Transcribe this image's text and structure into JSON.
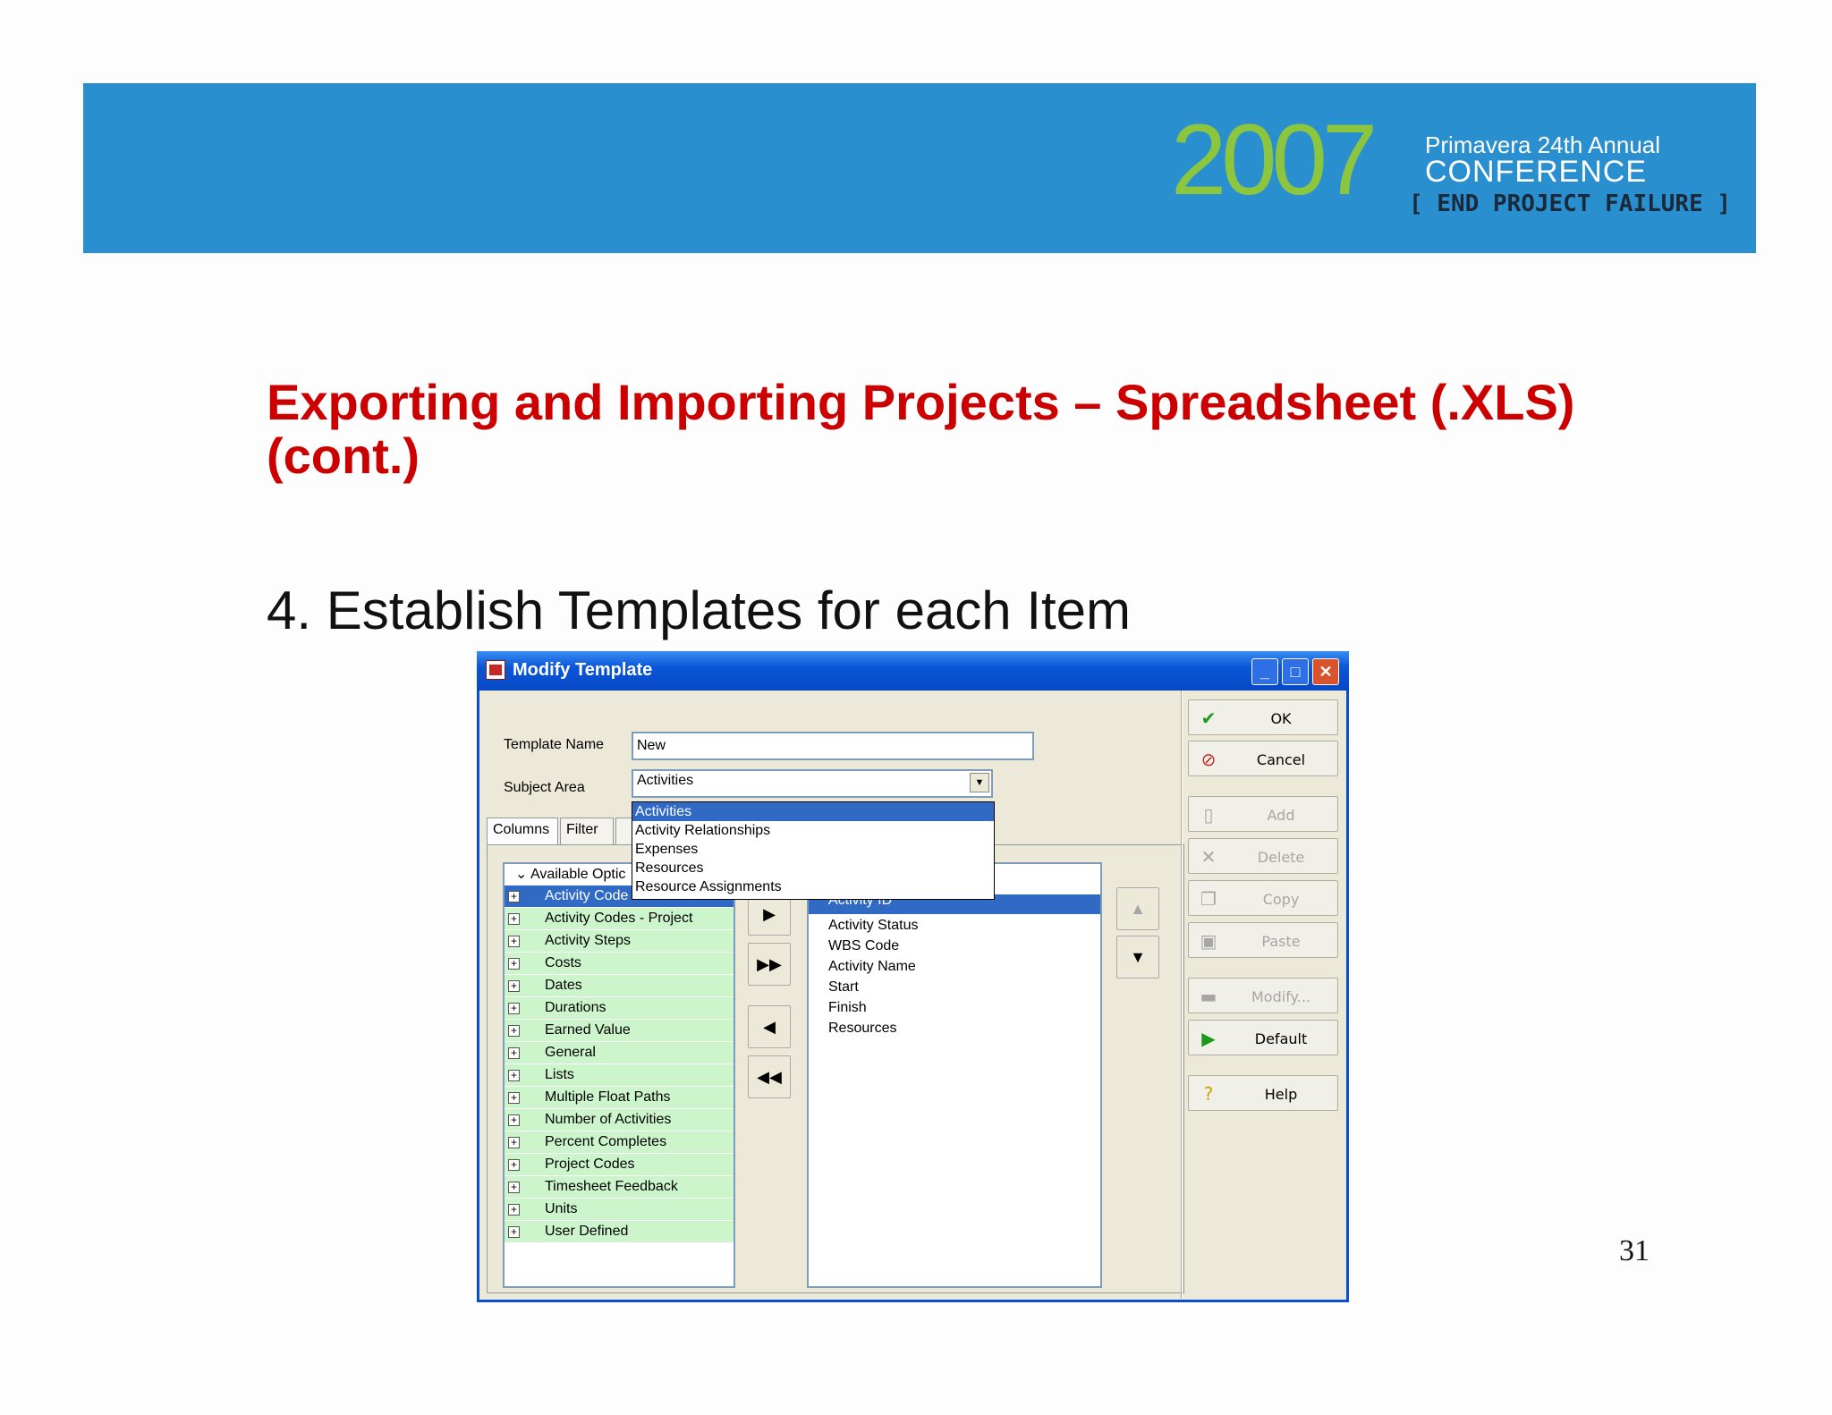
{
  "banner": {
    "year": "2007",
    "conference_line1": "Primavera 24th Annual",
    "conference_line2": "CONFERENCE",
    "tagline": "[ END PROJECT FAILURE ]"
  },
  "slide": {
    "title": "Exporting and Importing Projects – Spreadsheet (.XLS) (cont.)",
    "bullet": "4. Establish Templates for each Item",
    "page_number": "31"
  },
  "dialog": {
    "title": "Modify Template",
    "template_name_label": "Template Name",
    "template_name_value": "New",
    "subject_area_label": "Subject Area",
    "subject_area_value": "Activities",
    "subject_area_options": [
      "Activities",
      "Activity Relationships",
      "Expenses",
      "Resources",
      "Resource Assignments"
    ],
    "tabs": [
      "Columns",
      "Filter"
    ],
    "available_header": "Available Optic",
    "available_options": [
      "Activity Code",
      "Activity Codes - Project",
      "Activity Steps",
      "Costs",
      "Dates",
      "Durations",
      "Earned Value",
      "General",
      "Lists",
      "Multiple Float Paths",
      "Number of Activities",
      "Percent Completes",
      "Project Codes",
      "Timesheet Feedback",
      "Units",
      "User Defined"
    ],
    "selected_partial": "Activity ID",
    "selected_columns": [
      "Activity Status",
      "WBS Code",
      "Activity Name",
      "Start",
      "Finish",
      "Resources"
    ],
    "buttons": {
      "ok": "OK",
      "cancel": "Cancel",
      "add": "Add",
      "delete": "Delete",
      "copy": "Copy",
      "paste": "Paste",
      "modify": "Modify...",
      "default": "Default",
      "help": "Help"
    }
  }
}
